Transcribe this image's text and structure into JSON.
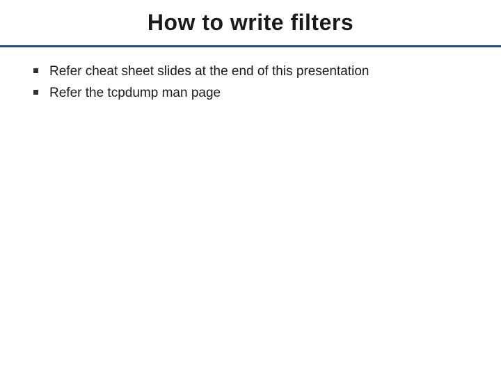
{
  "slide": {
    "title": "How to write filters",
    "bullets": [
      "Refer cheat sheet slides at the end of this presentation",
      "Refer the tcpdump man page"
    ]
  }
}
